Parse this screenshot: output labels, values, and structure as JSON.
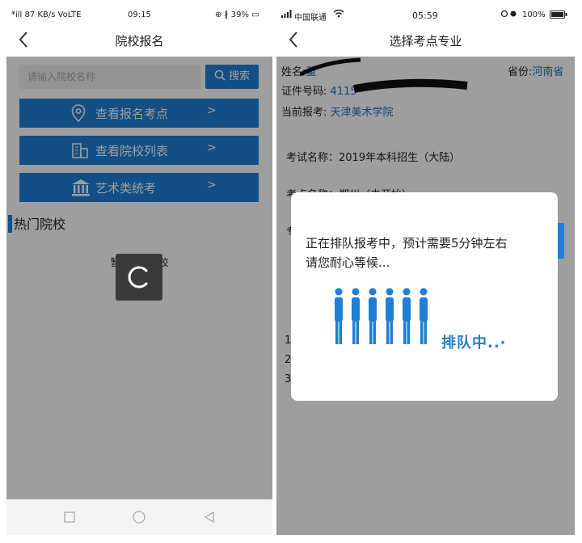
{
  "left_phone": {
    "status": {
      "signal": "*̈ill 87 KB/s VoLTE",
      "time": "09:15",
      "right": "⊕ ∦ 39% ▭"
    },
    "nav": {
      "title": "院校报名"
    },
    "search": {
      "placeholder": "请输入院校名称",
      "button": "搜索"
    },
    "menu": [
      {
        "label": "查看报名考点"
      },
      {
        "label": "查看院校列表"
      },
      {
        "label": "艺术类统考"
      }
    ],
    "hot_title": "热门院校",
    "no_hot": "暂无热门院校"
  },
  "right_phone": {
    "status": {
      "signal": "中国联通",
      "time": "05:59",
      "battery": "100%"
    },
    "nav": {
      "title": "选择考点专业"
    },
    "info": {
      "name_label": "姓名:",
      "name_value": "董",
      "province_label": "省份:",
      "province_value": "河南省",
      "id_label": "证件号码:",
      "id_value": "4115",
      "current_label": "当前报考:",
      "current_value": "天津美术学院",
      "exam_name": "考试名称：2019年本科招生（大陆）",
      "exam_place_partial": "考点名称：郑州（去开始）",
      "spec_partial": "专",
      "list_nums": [
        "1",
        "2",
        "3"
      ]
    },
    "dialog": {
      "line1": "正在排队报考中，预计需要5分钟左右",
      "line2": "请您耐心等候...",
      "queue_text": "排队中..·",
      "people_count": 6
    }
  },
  "colors": {
    "accent": "#1f7fd6",
    "overlay": "rgba(0,0,0,0.38)"
  }
}
